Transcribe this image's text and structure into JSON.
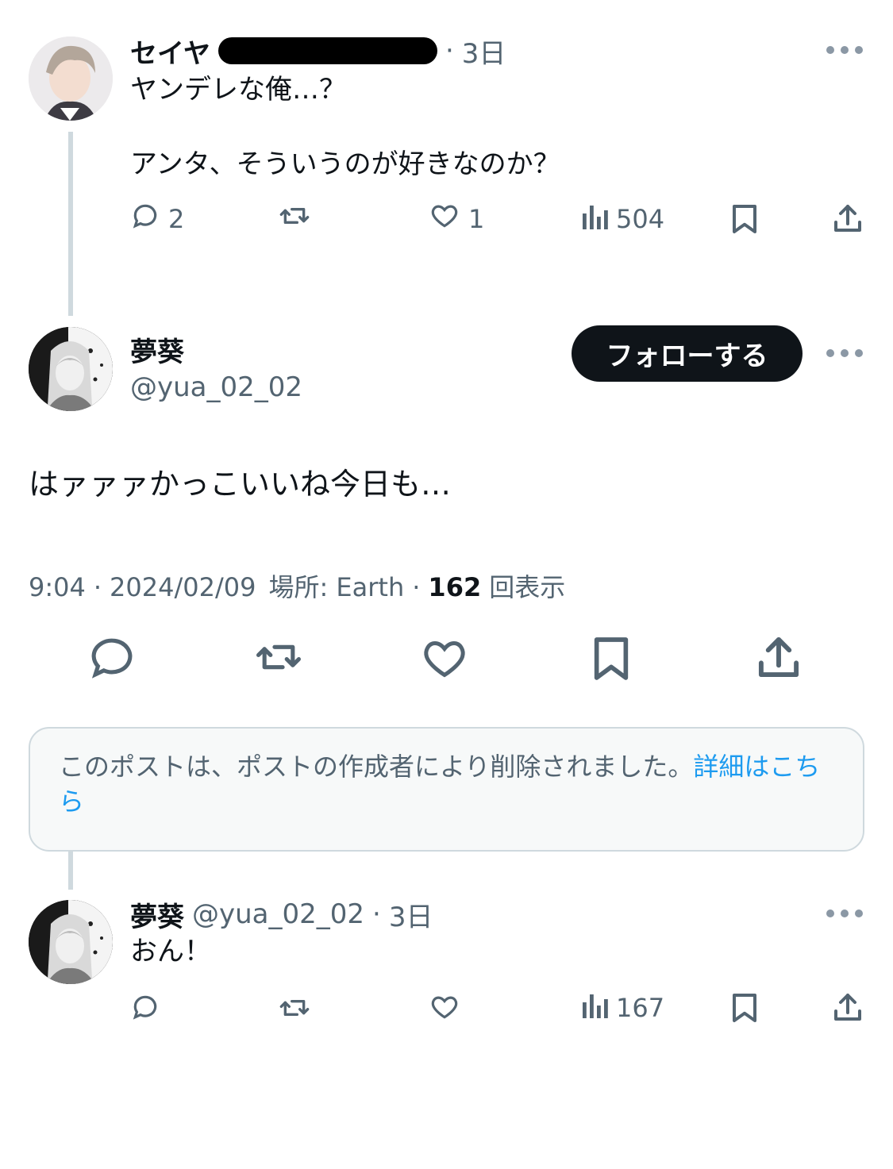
{
  "post1": {
    "author": "セイヤ",
    "dot": "·",
    "time": "3日",
    "line1": "ヤンデレな俺…？",
    "line2": "アンタ、そういうのが好きなのか？",
    "replies": "2",
    "likes": "1",
    "views": "504"
  },
  "main": {
    "author": "夢葵",
    "handle": "@yua_02_02",
    "follow_label": "フォローする",
    "text": "はァァァかっこいいね今日も…",
    "time": "9:04",
    "date": "2024/02/09",
    "location": "場所: Earth",
    "views_count": "162",
    "views_label": "回表示",
    "sep": "·"
  },
  "notice": {
    "text": "このポストは、ポストの作成者により削除されました。",
    "link": "詳細はこちら"
  },
  "reply": {
    "author": "夢葵",
    "handle": "@yua_02_02",
    "dot": "·",
    "time": "3日",
    "text": "おん！",
    "views": "167"
  },
  "colors": {
    "text": "#0f1419",
    "muted": "#536471",
    "link": "#1d9bf0",
    "border": "#cfd9de"
  }
}
